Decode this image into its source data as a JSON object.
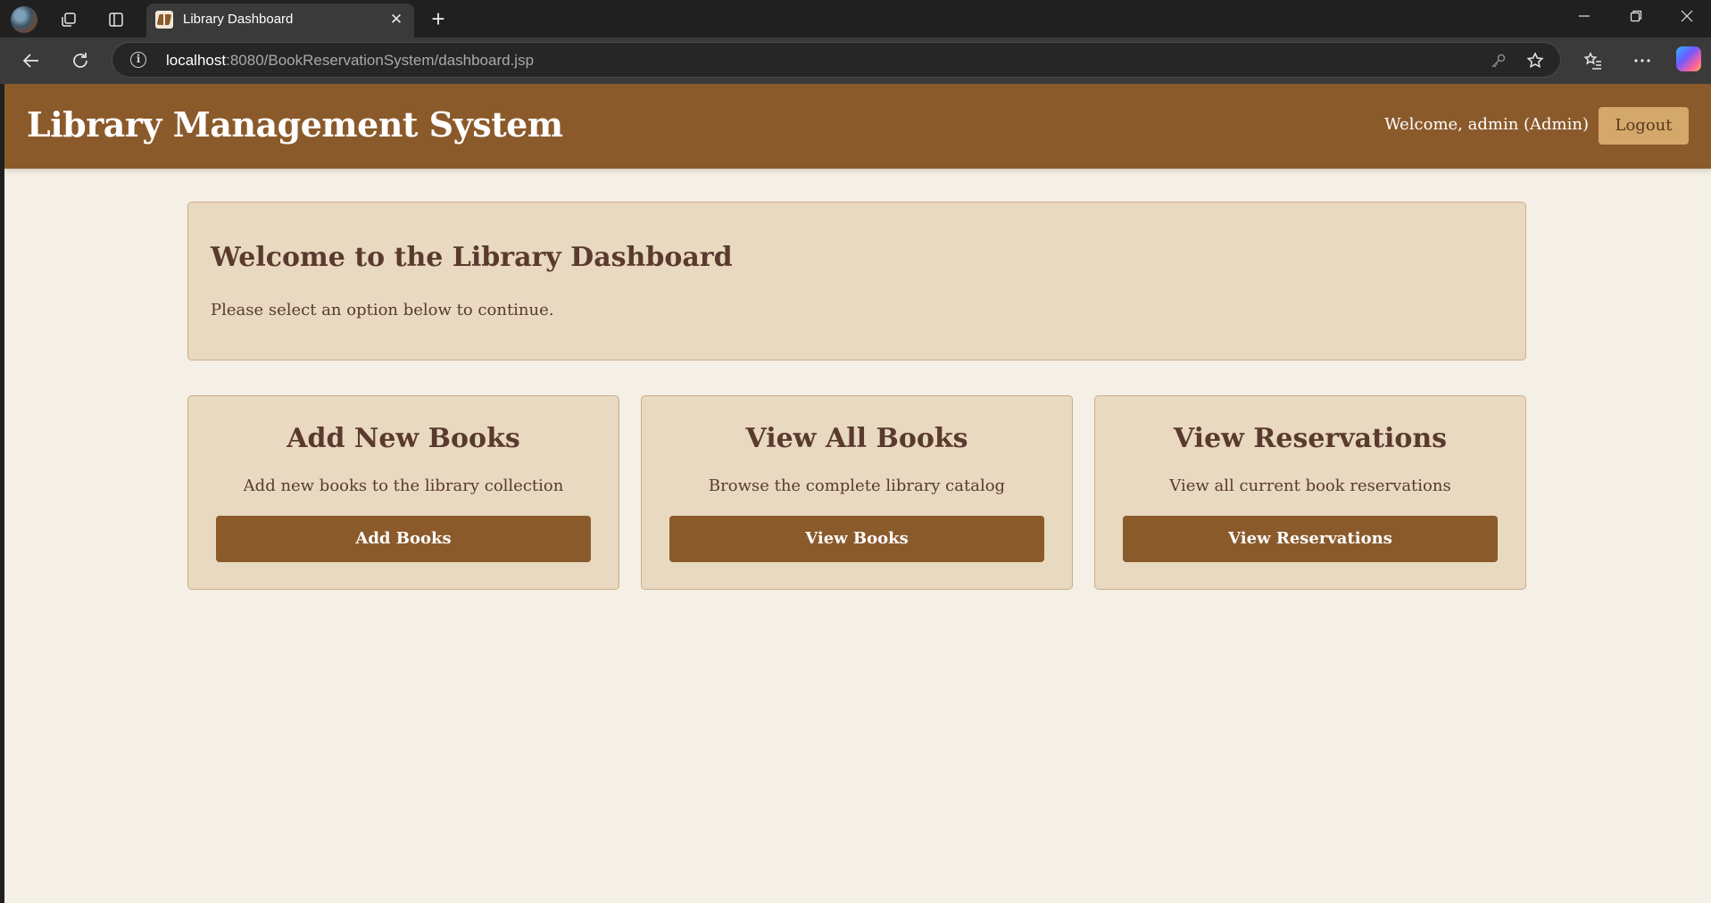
{
  "browser": {
    "tab_title": "Library Dashboard",
    "url_host": "localhost",
    "url_rest": ":8080/BookReservationSystem/dashboard.jsp"
  },
  "header": {
    "title": "Library Management System",
    "welcome_text": "Welcome, admin (Admin)",
    "logout_label": "Logout"
  },
  "welcome": {
    "heading": "Welcome to the Library Dashboard",
    "subtext": "Please select an option below to continue."
  },
  "cards": [
    {
      "title": "Add New Books",
      "description": "Add new books to the library collection",
      "button_label": "Add Books"
    },
    {
      "title": "View All Books",
      "description": "Browse the complete library catalog",
      "button_label": "View Books"
    },
    {
      "title": "View Reservations",
      "description": "View all current book reservations",
      "button_label": "View Reservations"
    }
  ],
  "colors": {
    "header_brown": "#8b5a2b",
    "page_background": "#f5f0e6",
    "panel_beige": "#e8d9c0",
    "logout_tan": "#d4a76a",
    "text_dark_brown": "#5a3a2e"
  },
  "icons": {
    "profile": "profile-avatar-icon",
    "workspaces": "workspaces-icon",
    "tab_actions": "tab-actions-icon",
    "tab_favicon": "library-book-favicon",
    "tab_close": "close-icon",
    "new_tab": "plus-icon",
    "minimize": "minimize-icon",
    "restore": "restore-icon",
    "close_window": "close-window-icon",
    "back": "back-arrow-icon",
    "refresh": "refresh-icon",
    "site_info": "info-icon",
    "password": "key-icon",
    "favorite": "star-icon",
    "favorites": "favorites-list-icon",
    "more": "more-dots-icon",
    "copilot": "copilot-icon"
  }
}
